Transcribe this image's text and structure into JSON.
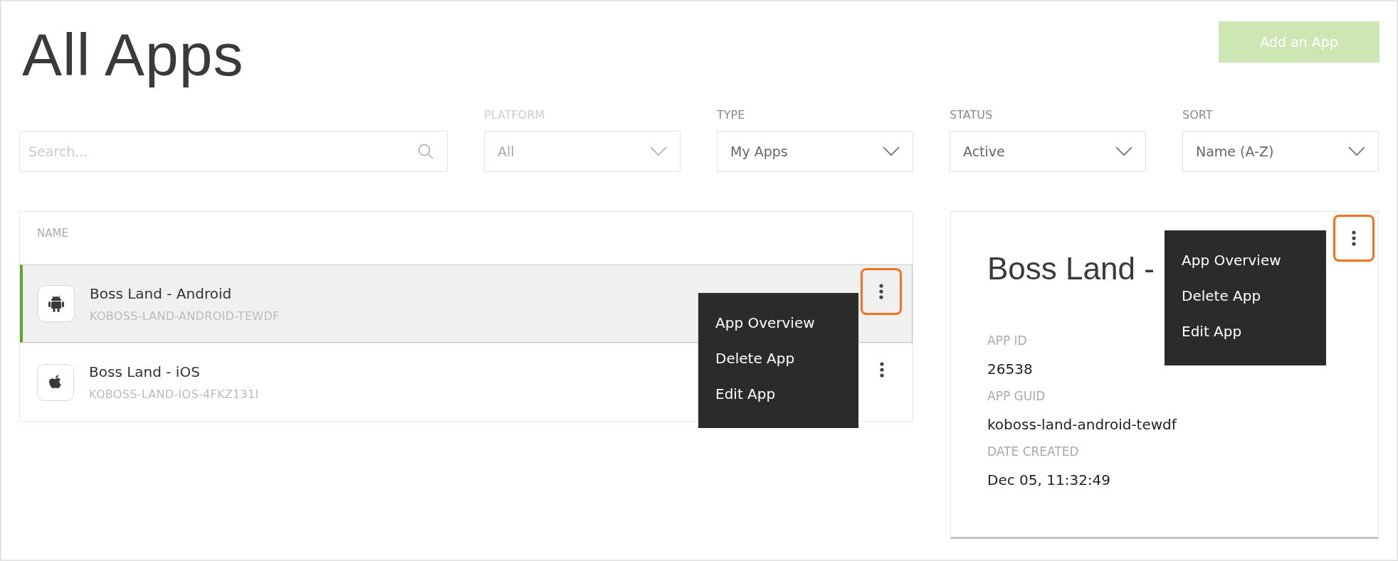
{
  "header": {
    "title": "All Apps",
    "add_button": {
      "label": "Add an App",
      "disabled": true
    }
  },
  "search": {
    "placeholder": "Search..."
  },
  "filters": [
    {
      "label": "PLATFORM",
      "value": "All",
      "disabled": true
    },
    {
      "label": "TYPE",
      "value": "My Apps",
      "disabled": false
    },
    {
      "label": "STATUS",
      "value": "Active",
      "disabled": false
    },
    {
      "label": "SORT",
      "value": "Name (A-Z)",
      "disabled": false
    }
  ],
  "list": {
    "column": "NAME",
    "rows": [
      {
        "name": "Boss Land - Android",
        "guid": "KOBOSS-LAND-ANDROID-TEWDF",
        "kind": "android",
        "selected": true,
        "menu_highlighted": true,
        "menu": [
          "App Overview",
          "Delete App",
          "Edit App"
        ]
      },
      {
        "name": "Boss Land - iOS",
        "guid": "KOBOSS-LAND-IOS-4FKZ131I",
        "kind": "apple",
        "selected": false,
        "menu_highlighted": false
      }
    ]
  },
  "detail": {
    "title": "Boss Land -",
    "menu_highlighted": true,
    "menu": [
      "App Overview",
      "Delete App",
      "Edit App"
    ],
    "fields": [
      {
        "label": "APP ID",
        "value": "26538"
      },
      {
        "label": "APP GUID",
        "value": "koboss-land-android-tewdf"
      },
      {
        "label": "DATE CREATED",
        "value": "Dec 05, 11:32:49"
      }
    ]
  }
}
